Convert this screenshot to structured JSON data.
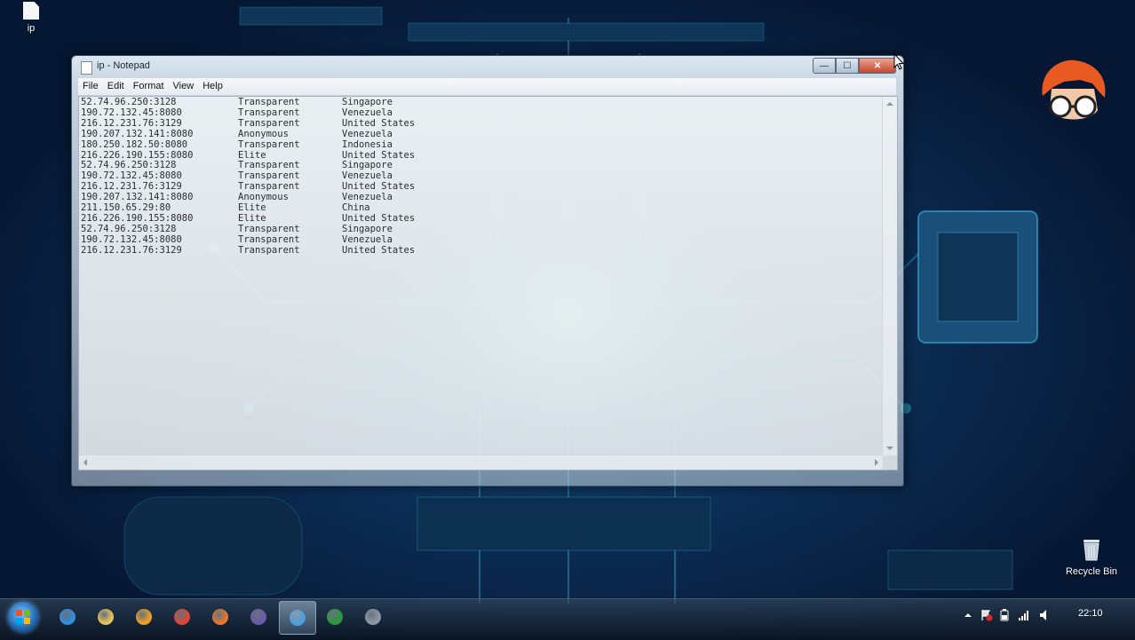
{
  "desktop": {
    "icons": [
      {
        "label": "ip"
      },
      {
        "label": "Recycle Bin"
      }
    ]
  },
  "window": {
    "title": "ip - Notepad",
    "buttons": {
      "minimize": "—",
      "maximize": "☐",
      "close": "✕"
    },
    "menu": [
      "File",
      "Edit",
      "Format",
      "View",
      "Help"
    ],
    "rows": [
      {
        "ip": "52.74.96.250:3128",
        "type": "Transparent",
        "country": "Singapore"
      },
      {
        "ip": "190.72.132.45:8080",
        "type": "Transparent",
        "country": "Venezuela"
      },
      {
        "ip": "216.12.231.76:3129",
        "type": "Transparent",
        "country": "United States"
      },
      {
        "ip": "190.207.132.141:8080",
        "type": "Anonymous",
        "country": "Venezuela"
      },
      {
        "ip": "180.250.182.50:8080",
        "type": "Transparent",
        "country": "Indonesia"
      },
      {
        "ip": "216.226.190.155:8080",
        "type": "Elite",
        "country": "United States"
      },
      {
        "ip": "52.74.96.250:3128",
        "type": "Transparent",
        "country": "Singapore"
      },
      {
        "ip": "190.72.132.45:8080",
        "type": "Transparent",
        "country": "Venezuela"
      },
      {
        "ip": "216.12.231.76:3129",
        "type": "Transparent",
        "country": "United States"
      },
      {
        "ip": "190.207.132.141:8080",
        "type": "Anonymous",
        "country": "Venezuela"
      },
      {
        "ip": "211.150.65.29:80",
        "type": "Elite",
        "country": "China"
      },
      {
        "ip": "216.226.190.155:8080",
        "type": "Elite",
        "country": "United States"
      },
      {
        "ip": "52.74.96.250:3128",
        "type": "Transparent",
        "country": "Singapore"
      },
      {
        "ip": "190.72.132.45:8080",
        "type": "Transparent",
        "country": "Venezuela"
      },
      {
        "ip": "216.12.231.76:3129",
        "type": "Transparent",
        "country": "United States"
      }
    ]
  },
  "taskbar": {
    "apps": [
      {
        "icon": "internet-explorer-icon",
        "color": "#2f8fe0",
        "active": false
      },
      {
        "icon": "folder-icon",
        "color": "#e8c35a",
        "active": false
      },
      {
        "icon": "media-player-icon",
        "color": "#f0a020",
        "active": false
      },
      {
        "icon": "chrome-icon",
        "color": "#e04434",
        "active": false
      },
      {
        "icon": "firefox-icon",
        "color": "#e8772a",
        "active": false
      },
      {
        "icon": "eclipse-icon",
        "color": "#6a5aa8",
        "active": false
      },
      {
        "icon": "browser-icon",
        "color": "#4aa0e0",
        "active": true
      },
      {
        "icon": "camtasia-icon",
        "color": "#2a9a3a",
        "active": false
      },
      {
        "icon": "notepad-icon",
        "color": "#8d98a4",
        "active": false
      }
    ],
    "clock": "22:10"
  }
}
